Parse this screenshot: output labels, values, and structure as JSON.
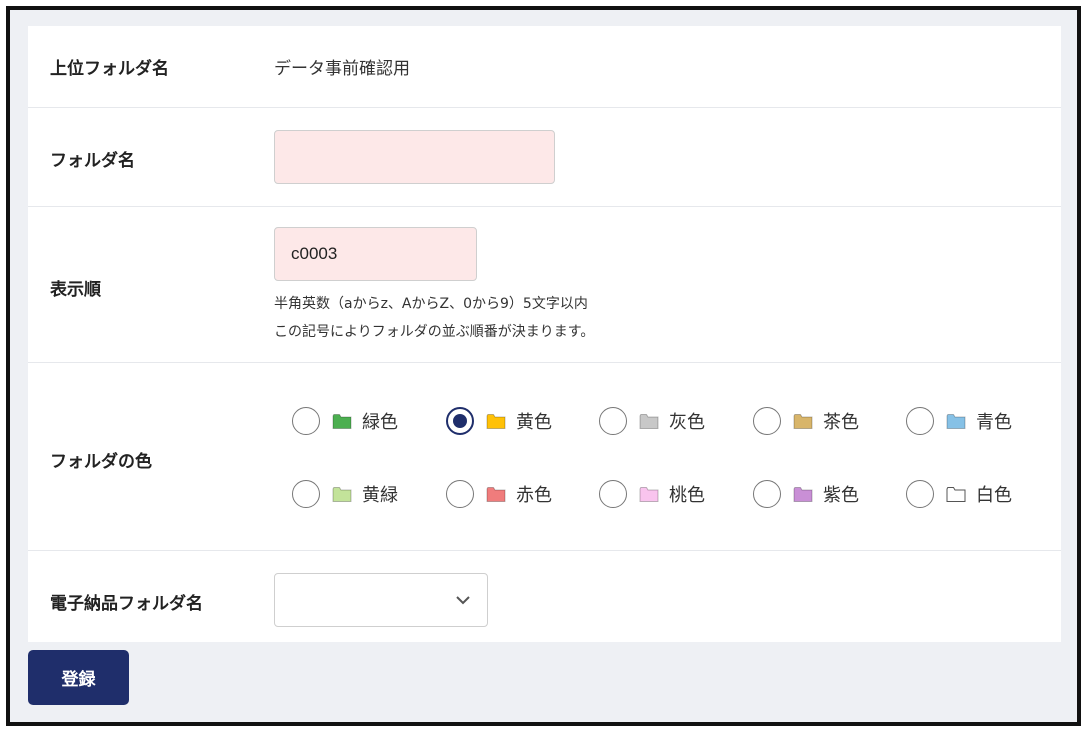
{
  "form": {
    "parent_folder": {
      "label": "上位フォルダ名",
      "value": "データ事前確認用"
    },
    "folder_name": {
      "label": "フォルダ名",
      "value": "",
      "placeholder": ""
    },
    "display_order": {
      "label": "表示順",
      "value": "c0003",
      "help1": "半角英数（aからz、AからZ、0から9）5文字以内",
      "help2": "この記号によりフォルダの並ぶ順番が決まります。"
    },
    "folder_color": {
      "label": "フォルダの色",
      "selected": "黄色",
      "options": [
        {
          "label": "緑色",
          "color": "#4caf50"
        },
        {
          "label": "黄色",
          "color": "#ffc107"
        },
        {
          "label": "灰色",
          "color": "#c8c8c8"
        },
        {
          "label": "茶色",
          "color": "#d8b56a"
        },
        {
          "label": "青色",
          "color": "#86c1e6"
        },
        {
          "label": "黄緑",
          "color": "#c3e39a"
        },
        {
          "label": "赤色",
          "color": "#f07c7c"
        },
        {
          "label": "桃色",
          "color": "#f9c4ee"
        },
        {
          "label": "紫色",
          "color": "#c98fd6"
        },
        {
          "label": "白色",
          "color": "#ffffff"
        }
      ]
    },
    "delivery_folder": {
      "label": "電子納品フォルダ名",
      "value": ""
    },
    "submit_label": "登録"
  },
  "colors": {
    "accent": "#1f2e6b",
    "input_bg": "#fde8e8"
  }
}
